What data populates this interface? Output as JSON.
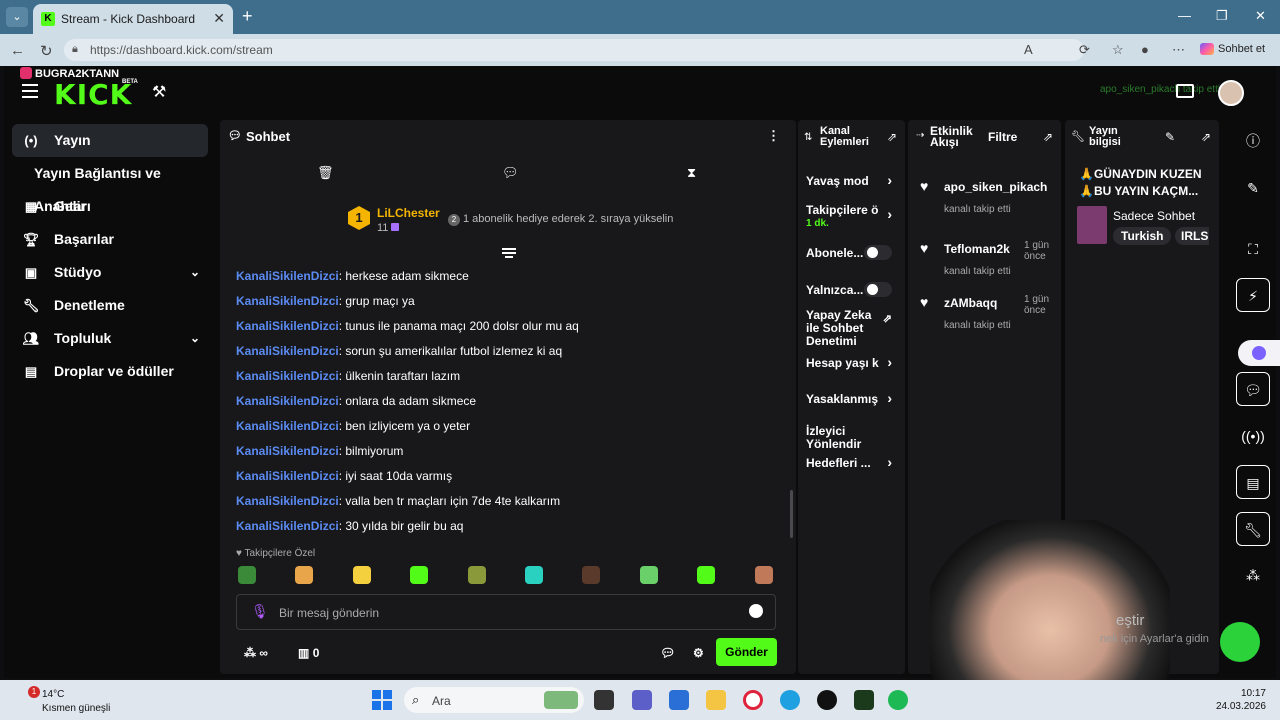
{
  "browser": {
    "tab_title": "Stream - Kick Dashboard",
    "url": "https://dashboard.kick.com/stream",
    "copilot_label": "Sohbet et"
  },
  "overlay": {
    "streamer_name": "BUGRA2KTANN",
    "follow_ticker": "apo_siken_pikach takip etti"
  },
  "brand": {
    "logo": "KICK",
    "beta": "BETA"
  },
  "sidebar": {
    "items": [
      {
        "label": "Yayın",
        "icon": "live-icon",
        "active": true
      },
      {
        "label": "Yayın Bağlantısı ve Anahtarı",
        "sub": true
      },
      {
        "label": "Gelir",
        "icon": "chart-icon"
      },
      {
        "label": "Başarılar",
        "icon": "trophy-icon"
      },
      {
        "label": "Stüdyo",
        "icon": "studio-icon",
        "expandable": true
      },
      {
        "label": "Denetleme",
        "icon": "wrench-icon"
      },
      {
        "label": "Topluluk",
        "icon": "people-icon",
        "expandable": true
      },
      {
        "label": "Droplar ve ödüller",
        "icon": "gift-icon"
      }
    ]
  },
  "chat": {
    "title": "Sohbet",
    "pinned": {
      "rank": "1",
      "user": "LiLChester",
      "count": "11",
      "message": "1 abonelik hediye ederek 2. sıraya yükselin",
      "message_badge": "2"
    },
    "messages": [
      {
        "user": "KanaliSikilenDizci",
        "text": ": herkese adam sikmece"
      },
      {
        "user": "KanaliSikilenDizci",
        "text": ": grup maçı ya"
      },
      {
        "user": "KanaliSikilenDizci",
        "text": ": tunus ile panama maçı 200 dolsr olur mu aq"
      },
      {
        "user": "KanaliSikilenDizci",
        "text": ": sorun şu amerikalılar futbol izlemez ki aq"
      },
      {
        "user": "KanaliSikilenDizci",
        "text": ": ülkenin taraftarı lazım"
      },
      {
        "user": "KanaliSikilenDizci",
        "text": ": onlara da adam sikmece"
      },
      {
        "user": "KanaliSikilenDizci",
        "text": ": ben izliyicem ya o yeter"
      },
      {
        "user": "KanaliSikilenDizci",
        "text": ": bilmiyorum"
      },
      {
        "user": "KanaliSikilenDizci",
        "text": ": iyi saat 10da varmış"
      },
      {
        "user": "KanaliSikilenDizci",
        "text": ": valla ben tr maçları için 7de 4te kalkarım"
      },
      {
        "user": "KanaliSikilenDizci",
        "text": ": 30 yılda bir gelir bu aq"
      }
    ],
    "followers_only_label": "Takipçilere Özel",
    "input_placeholder": "Bir mesaj gönderin",
    "points": "∞",
    "shop_count": "0",
    "send_label": "Gönder",
    "emote_colors": [
      "#3a8a3a",
      "#e8a54a",
      "#f4d03f",
      "#53fc18",
      "#8a9a3a",
      "#2ad0c0",
      "#5a3a2a",
      "#6ad06a",
      "#53fc18",
      "#c07a5a"
    ]
  },
  "actions": {
    "title_line1": "Kanal",
    "title_line2": "Eylemleri",
    "items": [
      {
        "label": "Yavaş mod",
        "type": "arrow"
      },
      {
        "label": "Takipçilere ö",
        "sub": "1 dk.",
        "type": "arrow"
      },
      {
        "label": "Abonele...",
        "type": "toggle"
      },
      {
        "label": "Yalnızca...",
        "type": "toggle"
      },
      {
        "label_lines": [
          "Yapay Zeka",
          "ile Sohbet",
          "Denetimi"
        ],
        "type": "link"
      },
      {
        "label": "Hesap yaşı k",
        "type": "arrow"
      },
      {
        "label": "Yasaklanmış",
        "type": "arrow"
      },
      {
        "label": "İzleyici Yönlendir",
        "type": "none"
      },
      {
        "label": "Hedefleri ...",
        "type": "arrow"
      }
    ]
  },
  "activity": {
    "title_line1": "Etkinlik",
    "title_line2": "Akışı",
    "filter": "Filtre",
    "events": [
      {
        "user": "apo_siken_pikach",
        "desc": "kanalı takip etti",
        "time": ""
      },
      {
        "user": "Tefloman2k",
        "desc": "kanalı takip etti",
        "time1": "1 gün",
        "time2": "önce"
      },
      {
        "user": "zAMbaqq",
        "desc": "kanalı takip etti",
        "time1": "1 gün",
        "time2": "önce"
      }
    ]
  },
  "stream_info": {
    "title_line1": "Yayın",
    "title_line2": "bilgisi",
    "stream_title_1": "🙏GÜNAYDIN KUZEN",
    "stream_title_2": "🙏BU YAYIN KAÇM...",
    "category": "Sadece Sohbet",
    "tags": [
      "Turkish",
      "IRLS"
    ]
  },
  "webcam_overlay": {
    "text1": "eştir",
    "text2": "nek için Ayarlar'a gidin"
  },
  "taskbar": {
    "weather_badge": "1",
    "temp": "14°C",
    "weather_desc": "Kısmen güneşli",
    "search_label": "Ara",
    "time": "10:17",
    "date": "24.03.2026"
  }
}
